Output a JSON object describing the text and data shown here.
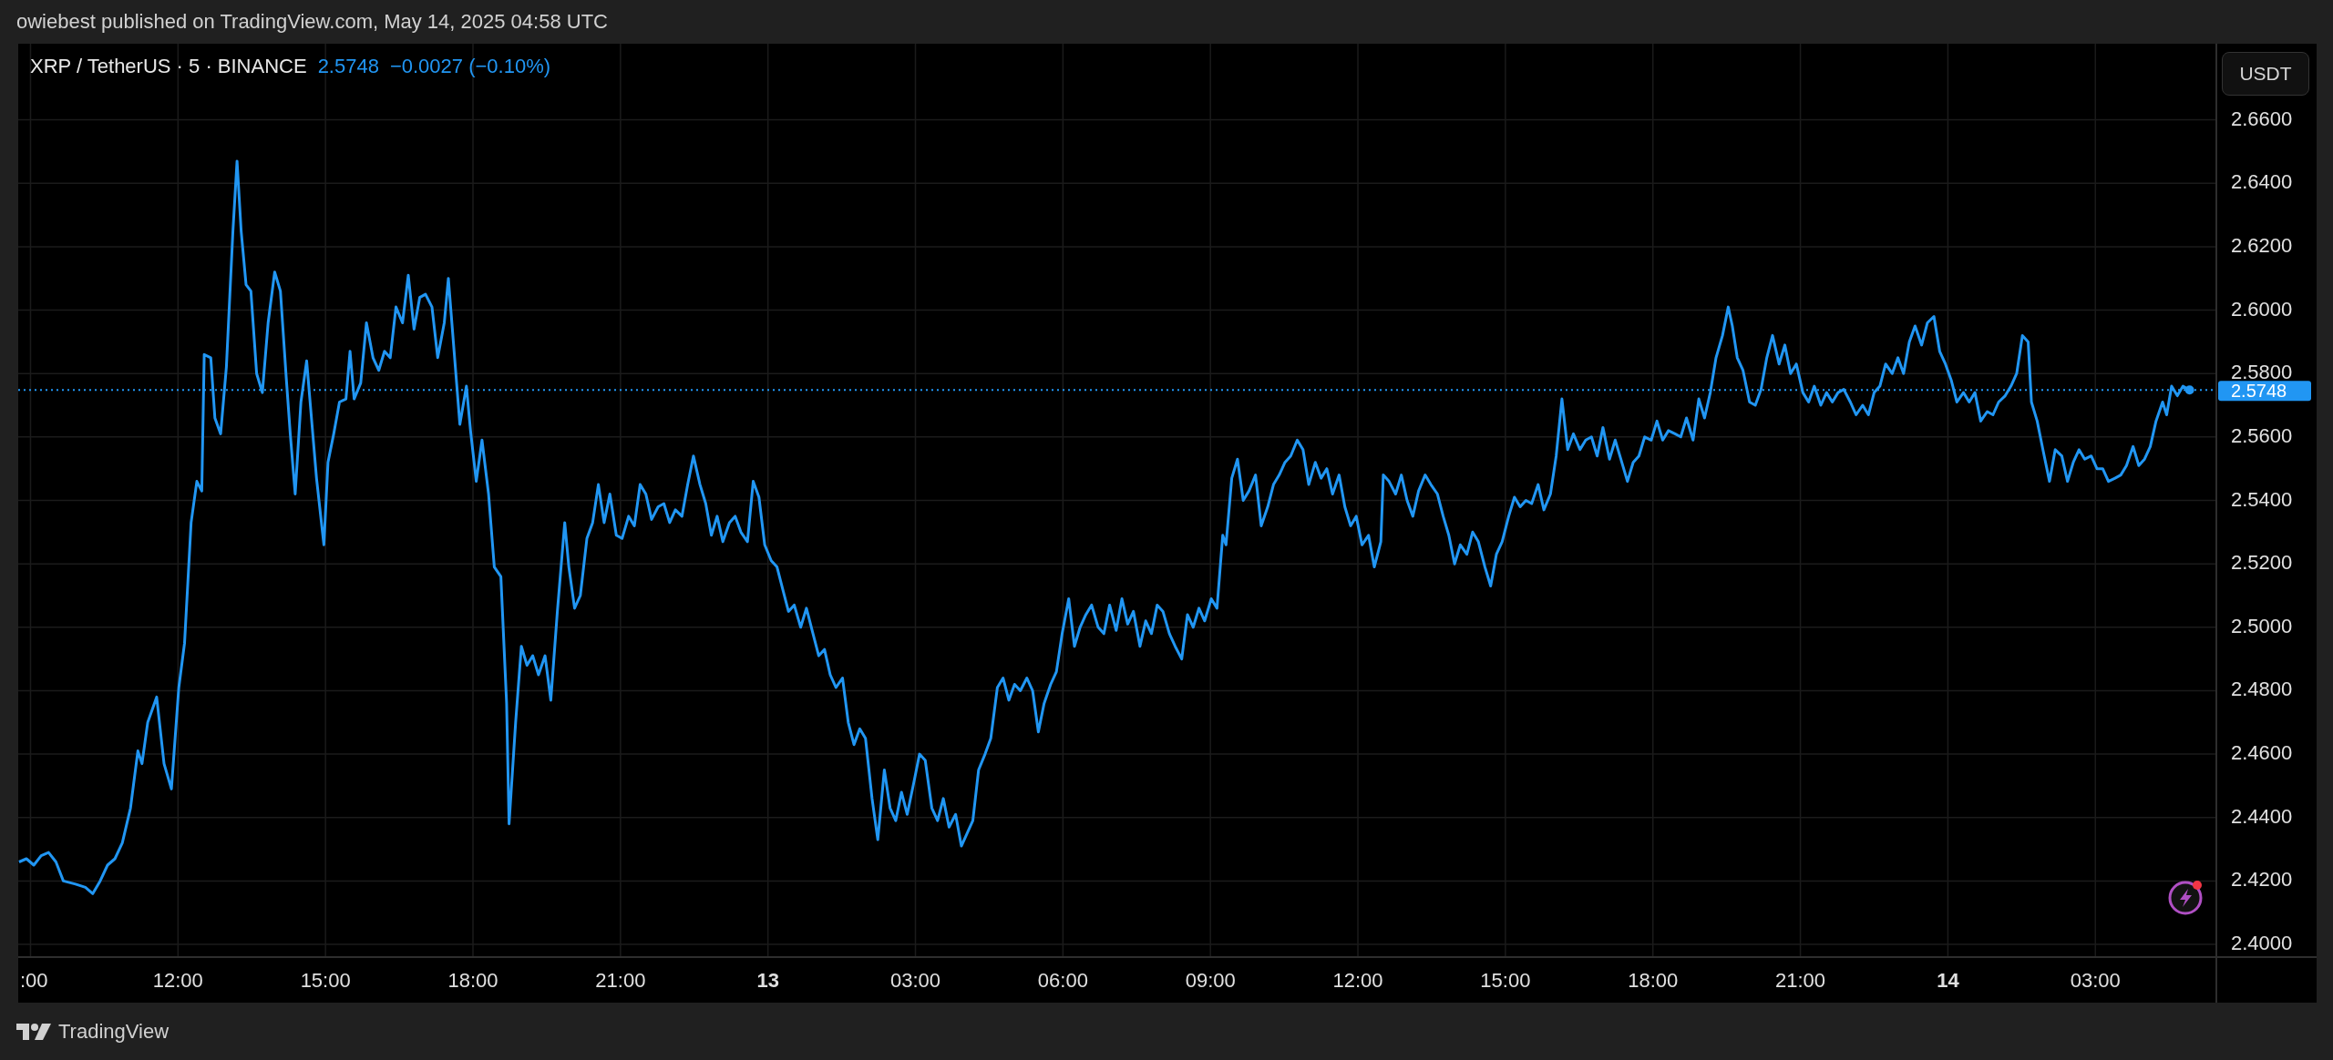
{
  "header": {
    "text": "owiebest published on TradingView.com, May 14, 2025 04:58 UTC"
  },
  "legend": {
    "symbol": "XRP / TetherUS · 5 · BINANCE",
    "price": "2.5748",
    "change": "−0.0027 (−0.10%)"
  },
  "currency_button": {
    "label": "USDT"
  },
  "chart": {
    "chart_data": {
      "type": "line",
      "x": [
        "2025-05-12T08:46",
        "2025-05-12T08:55",
        "2025-05-12T09:04",
        "2025-05-12T09:13",
        "2025-05-12T09:22",
        "2025-05-12T09:31",
        "2025-05-12T09:40",
        "2025-05-12T09:55",
        "2025-05-12T10:07",
        "2025-05-12T10:16",
        "2025-05-12T10:25",
        "2025-05-12T10:34",
        "2025-05-12T10:43",
        "2025-05-12T10:52",
        "2025-05-12T11:02",
        "2025-05-12T11:11",
        "2025-05-12T11:16",
        "2025-05-12T11:23",
        "2025-05-12T11:34",
        "2025-05-12T11:43",
        "2025-05-12T11:52",
        "2025-05-12T12:01",
        "2025-05-12T12:08",
        "2025-05-12T12:16",
        "2025-05-12T12:23",
        "2025-05-12T12:29",
        "2025-05-12T12:32",
        "2025-05-12T12:40",
        "2025-05-12T12:45",
        "2025-05-12T12:52",
        "2025-05-12T12:59",
        "2025-05-12T13:07",
        "2025-05-12T13:12",
        "2025-05-12T13:17",
        "2025-05-12T13:23",
        "2025-05-12T13:29",
        "2025-05-12T13:36",
        "2025-05-12T13:43",
        "2025-05-12T13:50",
        "2025-05-12T13:58",
        "2025-05-12T14:05",
        "2025-05-12T14:12",
        "2025-05-12T14:17",
        "2025-05-12T14:23",
        "2025-05-12T14:30",
        "2025-05-12T14:37",
        "2025-05-12T14:49",
        "2025-05-12T14:58",
        "2025-05-12T15:03",
        "2025-05-12T15:10",
        "2025-05-12T15:17",
        "2025-05-12T15:25",
        "2025-05-12T15:30",
        "2025-05-12T15:35",
        "2025-05-12T15:43",
        "2025-05-12T15:50",
        "2025-05-12T15:58",
        "2025-05-12T16:05",
        "2025-05-12T16:12",
        "2025-05-12T16:19",
        "2025-05-12T16:26",
        "2025-05-12T16:34",
        "2025-05-12T16:41",
        "2025-05-12T16:48",
        "2025-05-12T16:55",
        "2025-05-12T17:02",
        "2025-05-12T17:10",
        "2025-05-12T17:17",
        "2025-05-12T17:25",
        "2025-05-12T17:30",
        "2025-05-12T17:37",
        "2025-05-12T17:44",
        "2025-05-12T17:52",
        "2025-05-12T17:57",
        "2025-05-12T18:04",
        "2025-05-12T18:11",
        "2025-05-12T18:19",
        "2025-05-12T18:26",
        "2025-05-12T18:34",
        "2025-05-12T18:41",
        "2025-05-12T18:44",
        "2025-05-12T18:52",
        "2025-05-12T18:59",
        "2025-05-12T19:06",
        "2025-05-12T19:13",
        "2025-05-12T19:20",
        "2025-05-12T19:28",
        "2025-05-12T19:35",
        "2025-05-12T19:43",
        "2025-05-12T19:52",
        "2025-05-12T19:57",
        "2025-05-12T20:04",
        "2025-05-12T20:11",
        "2025-05-12T20:19",
        "2025-05-12T20:26",
        "2025-05-12T20:33",
        "2025-05-12T20:40",
        "2025-05-12T20:47",
        "2025-05-12T20:55",
        "2025-05-12T21:02",
        "2025-05-12T21:10",
        "2025-05-12T21:17",
        "2025-05-12T21:24",
        "2025-05-12T21:31",
        "2025-05-12T21:38",
        "2025-05-12T21:46",
        "2025-05-12T21:53",
        "2025-05-12T22:00",
        "2025-05-12T22:07",
        "2025-05-12T22:15",
        "2025-05-12T22:22",
        "2025-05-12T22:29",
        "2025-05-12T22:37",
        "2025-05-12T22:44",
        "2025-05-12T22:51",
        "2025-05-12T22:58",
        "2025-05-12T23:05",
        "2025-05-12T23:13",
        "2025-05-12T23:20",
        "2025-05-12T23:27",
        "2025-05-12T23:35",
        "2025-05-12T23:42",
        "2025-05-12T23:49",
        "2025-05-12T23:56",
        "2025-05-13T00:04",
        "2025-05-13T00:11",
        "2025-05-13T00:18",
        "2025-05-13T00:25",
        "2025-05-13T00:32",
        "2025-05-13T00:40",
        "2025-05-13T00:47",
        "2025-05-13T00:55",
        "2025-05-13T01:02",
        "2025-05-13T01:09",
        "2025-05-13T01:16",
        "2025-05-13T01:23",
        "2025-05-13T01:31",
        "2025-05-13T01:38",
        "2025-05-13T01:45",
        "2025-05-13T01:52",
        "2025-05-13T01:59",
        "2025-05-13T02:07",
        "2025-05-13T02:14",
        "2025-05-13T02:22",
        "2025-05-13T02:29",
        "2025-05-13T02:36",
        "2025-05-13T02:43",
        "2025-05-13T02:50",
        "2025-05-13T02:58",
        "2025-05-13T03:05",
        "2025-05-13T03:12",
        "2025-05-13T03:20",
        "2025-05-13T03:27",
        "2025-05-13T03:34",
        "2025-05-13T03:41",
        "2025-05-13T03:49",
        "2025-05-13T03:56",
        "2025-05-13T04:03",
        "2025-05-13T04:10",
        "2025-05-13T04:17",
        "2025-05-13T04:25",
        "2025-05-13T04:32",
        "2025-05-13T04:40",
        "2025-05-13T04:47",
        "2025-05-13T04:54",
        "2025-05-13T05:01",
        "2025-05-13T05:08",
        "2025-05-13T05:16",
        "2025-05-13T05:23",
        "2025-05-13T05:30",
        "2025-05-13T05:37",
        "2025-05-13T05:45",
        "2025-05-13T05:52",
        "2025-05-13T05:59",
        "2025-05-13T06:07",
        "2025-05-13T06:14",
        "2025-05-13T06:21",
        "2025-05-13T06:28",
        "2025-05-13T06:35",
        "2025-05-13T06:43",
        "2025-05-13T06:50",
        "2025-05-13T06:57",
        "2025-05-13T07:05",
        "2025-05-13T07:12",
        "2025-05-13T07:19",
        "2025-05-13T07:26",
        "2025-05-13T07:34",
        "2025-05-13T07:41",
        "2025-05-13T07:48",
        "2025-05-13T07:55",
        "2025-05-13T08:02",
        "2025-05-13T08:10",
        "2025-05-13T08:17",
        "2025-05-13T08:25",
        "2025-05-13T08:32",
        "2025-05-13T08:39",
        "2025-05-13T08:46",
        "2025-05-13T08:53",
        "2025-05-13T09:01",
        "2025-05-13T09:08",
        "2025-05-13T09:15",
        "2025-05-13T09:19",
        "2025-05-13T09:26",
        "2025-05-13T09:33",
        "2025-05-13T09:40",
        "2025-05-13T09:47",
        "2025-05-13T09:55",
        "2025-05-13T10:02",
        "2025-05-13T10:10",
        "2025-05-13T10:17",
        "2025-05-13T10:24",
        "2025-05-13T10:31",
        "2025-05-13T10:38",
        "2025-05-13T10:46",
        "2025-05-13T10:53",
        "2025-05-13T11:00",
        "2025-05-13T11:08",
        "2025-05-13T11:15",
        "2025-05-13T11:22",
        "2025-05-13T11:29",
        "2025-05-13T11:37",
        "2025-05-13T11:44",
        "2025-05-13T11:51",
        "2025-05-13T11:58",
        "2025-05-13T12:05",
        "2025-05-13T12:13",
        "2025-05-13T12:20",
        "2025-05-13T12:28",
        "2025-05-13T12:31",
        "2025-05-13T12:38",
        "2025-05-13T12:46",
        "2025-05-13T12:53",
        "2025-05-13T13:00",
        "2025-05-13T13:07",
        "2025-05-13T13:14",
        "2025-05-13T13:22",
        "2025-05-13T13:29",
        "2025-05-13T13:37",
        "2025-05-13T13:44",
        "2025-05-13T13:51",
        "2025-05-13T13:58",
        "2025-05-13T14:05",
        "2025-05-13T14:13",
        "2025-05-13T14:20",
        "2025-05-13T14:27",
        "2025-05-13T14:35",
        "2025-05-13T14:42",
        "2025-05-13T14:49",
        "2025-05-13T14:56",
        "2025-05-13T15:04",
        "2025-05-13T15:11",
        "2025-05-13T15:18",
        "2025-05-13T15:25",
        "2025-05-13T15:32",
        "2025-05-13T15:40",
        "2025-05-13T15:47",
        "2025-05-13T15:55",
        "2025-05-13T16:02",
        "2025-05-13T16:09",
        "2025-05-13T16:16",
        "2025-05-13T16:23",
        "2025-05-13T16:31",
        "2025-05-13T16:38",
        "2025-05-13T16:45",
        "2025-05-13T16:52",
        "2025-05-13T16:59",
        "2025-05-13T17:07",
        "2025-05-13T17:14",
        "2025-05-13T17:22",
        "2025-05-13T17:29",
        "2025-05-13T17:36",
        "2025-05-13T17:43",
        "2025-05-13T17:50",
        "2025-05-13T17:58",
        "2025-05-13T18:05",
        "2025-05-13T18:12",
        "2025-05-13T18:19",
        "2025-05-13T18:27",
        "2025-05-13T18:34",
        "2025-05-13T18:41",
        "2025-05-13T18:49",
        "2025-05-13T18:56",
        "2025-05-13T19:03",
        "2025-05-13T19:10",
        "2025-05-13T19:17",
        "2025-05-13T19:25",
        "2025-05-13T19:32",
        "2025-05-13T19:37",
        "2025-05-13T19:43",
        "2025-05-13T19:50",
        "2025-05-13T19:58",
        "2025-05-13T20:05",
        "2025-05-13T20:12",
        "2025-05-13T20:19",
        "2025-05-13T20:26",
        "2025-05-13T20:34",
        "2025-05-13T20:41",
        "2025-05-13T20:48",
        "2025-05-13T20:55",
        "2025-05-13T21:03",
        "2025-05-13T21:10",
        "2025-05-13T21:17",
        "2025-05-13T21:25",
        "2025-05-13T21:32",
        "2025-05-13T21:39",
        "2025-05-13T21:46",
        "2025-05-13T21:53",
        "2025-05-13T22:01",
        "2025-05-13T22:08",
        "2025-05-13T22:16",
        "2025-05-13T22:23",
        "2025-05-13T22:30",
        "2025-05-13T22:37",
        "2025-05-13T22:44",
        "2025-05-13T22:52",
        "2025-05-13T22:59",
        "2025-05-13T23:06",
        "2025-05-13T23:13",
        "2025-05-13T23:20",
        "2025-05-13T23:28",
        "2025-05-13T23:35",
        "2025-05-13T23:43",
        "2025-05-13T23:50",
        "2025-05-13T23:57",
        "2025-05-14T00:04",
        "2025-05-14T00:11",
        "2025-05-14T00:19",
        "2025-05-14T00:26",
        "2025-05-14T00:33",
        "2025-05-14T00:40",
        "2025-05-14T00:48",
        "2025-05-14T00:55",
        "2025-05-14T01:02",
        "2025-05-14T01:10",
        "2025-05-14T01:17",
        "2025-05-14T01:24",
        "2025-05-14T01:31",
        "2025-05-14T01:38",
        "2025-05-14T01:42",
        "2025-05-14T01:49",
        "2025-05-14T01:56",
        "2025-05-14T02:04",
        "2025-05-14T02:11",
        "2025-05-14T02:19",
        "2025-05-14T02:26",
        "2025-05-14T02:33",
        "2025-05-14T02:40",
        "2025-05-14T02:47",
        "2025-05-14T02:55",
        "2025-05-14T03:02",
        "2025-05-14T03:09",
        "2025-05-14T03:16",
        "2025-05-14T03:24",
        "2025-05-14T03:31",
        "2025-05-14T03:38",
        "2025-05-14T03:46",
        "2025-05-14T03:53",
        "2025-05-14T04:00",
        "2025-05-14T04:07",
        "2025-05-14T04:14",
        "2025-05-14T04:22",
        "2025-05-14T04:27",
        "2025-05-14T04:33",
        "2025-05-14T04:40",
        "2025-05-14T04:47",
        "2025-05-14T04:55"
      ],
      "series": [
        {
          "color": "#2196f3",
          "values": [
            2.426,
            2.427,
            2.425,
            2.428,
            2.429,
            2.426,
            2.42,
            2.419,
            2.418,
            2.416,
            2.42,
            2.425,
            2.427,
            2.432,
            2.443,
            2.461,
            2.457,
            2.47,
            2.478,
            2.457,
            2.449,
            2.481,
            2.495,
            2.533,
            2.546,
            2.543,
            2.586,
            2.585,
            2.566,
            2.561,
            2.582,
            2.625,
            2.647,
            2.625,
            2.608,
            2.606,
            2.58,
            2.574,
            2.596,
            2.612,
            2.606,
            2.579,
            2.561,
            2.542,
            2.571,
            2.584,
            2.547,
            2.526,
            2.552,
            2.561,
            2.571,
            2.572,
            2.587,
            2.572,
            2.577,
            2.596,
            2.585,
            2.581,
            2.587,
            2.585,
            2.601,
            2.596,
            2.611,
            2.594,
            2.604,
            2.605,
            2.601,
            2.585,
            2.596,
            2.61,
            2.587,
            2.564,
            2.576,
            2.562,
            2.546,
            2.559,
            2.542,
            2.519,
            2.516,
            2.476,
            2.438,
            2.47,
            2.494,
            2.488,
            2.491,
            2.485,
            2.491,
            2.477,
            2.505,
            2.533,
            2.519,
            2.506,
            2.51,
            2.528,
            2.533,
            2.545,
            2.533,
            2.542,
            2.529,
            2.528,
            2.535,
            2.532,
            2.545,
            2.542,
            2.534,
            2.538,
            2.539,
            2.533,
            2.537,
            2.535,
            2.545,
            2.554,
            2.545,
            2.539,
            2.529,
            2.535,
            2.527,
            2.533,
            2.535,
            2.53,
            2.527,
            2.546,
            2.541,
            2.526,
            2.521,
            2.519,
            2.512,
            2.505,
            2.507,
            2.5,
            2.506,
            2.498,
            2.491,
            2.493,
            2.485,
            2.481,
            2.484,
            2.47,
            2.463,
            2.468,
            2.465,
            2.446,
            2.433,
            2.455,
            2.443,
            2.439,
            2.448,
            2.441,
            2.451,
            2.46,
            2.458,
            2.443,
            2.439,
            2.446,
            2.437,
            2.441,
            2.431,
            2.435,
            2.439,
            2.455,
            2.46,
            2.465,
            2.481,
            2.484,
            2.477,
            2.482,
            2.48,
            2.484,
            2.48,
            2.467,
            2.476,
            2.482,
            2.486,
            2.498,
            2.509,
            2.494,
            2.5,
            2.504,
            2.507,
            2.5,
            2.498,
            2.507,
            2.499,
            2.509,
            2.501,
            2.505,
            2.494,
            2.502,
            2.498,
            2.507,
            2.505,
            2.498,
            2.494,
            2.49,
            2.504,
            2.5,
            2.506,
            2.502,
            2.509,
            2.506,
            2.529,
            2.526,
            2.547,
            2.553,
            2.54,
            2.543,
            2.548,
            2.532,
            2.538,
            2.545,
            2.548,
            2.552,
            2.554,
            2.559,
            2.556,
            2.545,
            2.552,
            2.547,
            2.55,
            2.542,
            2.548,
            2.538,
            2.532,
            2.535,
            2.526,
            2.529,
            2.519,
            2.527,
            2.548,
            2.546,
            2.542,
            2.548,
            2.54,
            2.535,
            2.543,
            2.548,
            2.545,
            2.542,
            2.535,
            2.529,
            2.52,
            2.526,
            2.523,
            2.53,
            2.527,
            2.519,
            2.513,
            2.523,
            2.527,
            2.535,
            2.541,
            2.538,
            2.54,
            2.539,
            2.545,
            2.537,
            2.542,
            2.554,
            2.572,
            2.556,
            2.561,
            2.556,
            2.559,
            2.56,
            2.554,
            2.563,
            2.553,
            2.559,
            2.552,
            2.546,
            2.552,
            2.554,
            2.56,
            2.559,
            2.565,
            2.559,
            2.562,
            2.561,
            2.56,
            2.566,
            2.559,
            2.572,
            2.566,
            2.574,
            2.585,
            2.592,
            2.601,
            2.595,
            2.585,
            2.581,
            2.571,
            2.57,
            2.575,
            2.585,
            2.592,
            2.583,
            2.589,
            2.58,
            2.583,
            2.574,
            2.571,
            2.576,
            2.57,
            2.574,
            2.571,
            2.574,
            2.575,
            2.571,
            2.567,
            2.57,
            2.567,
            2.574,
            2.576,
            2.583,
            2.58,
            2.585,
            2.58,
            2.59,
            2.595,
            2.589,
            2.596,
            2.598,
            2.587,
            2.583,
            2.578,
            2.571,
            2.574,
            2.571,
            2.574,
            2.565,
            2.568,
            2.567,
            2.571,
            2.573,
            2.576,
            2.58,
            2.592,
            2.59,
            2.571,
            2.565,
            2.556,
            2.546,
            2.556,
            2.554,
            2.546,
            2.552,
            2.556,
            2.553,
            2.554,
            2.55,
            2.55,
            2.546,
            2.547,
            2.548,
            2.551,
            2.557,
            2.551,
            2.553,
            2.557,
            2.565,
            2.571,
            2.567,
            2.576,
            2.573,
            2.576,
            2.5748
          ]
        }
      ],
      "xlim": [
        "2025-05-12T08:45",
        "2025-05-14T07:30"
      ],
      "ylim": [
        2.396,
        2.684
      ],
      "grid": true,
      "xticks": [
        {
          "value": "2025-05-12T09:00",
          "label": ":00"
        },
        {
          "value": "2025-05-12T12:00",
          "label": "12:00"
        },
        {
          "value": "2025-05-12T15:00",
          "label": "15:00"
        },
        {
          "value": "2025-05-12T18:00",
          "label": "18:00"
        },
        {
          "value": "2025-05-12T21:00",
          "label": "21:00"
        },
        {
          "value": "2025-05-13T00:00",
          "label": "13"
        },
        {
          "value": "2025-05-13T03:00",
          "label": "03:00"
        },
        {
          "value": "2025-05-13T06:00",
          "label": "06:00"
        },
        {
          "value": "2025-05-13T09:00",
          "label": "09:00"
        },
        {
          "value": "2025-05-13T12:00",
          "label": "12:00"
        },
        {
          "value": "2025-05-13T15:00",
          "label": "15:00"
        },
        {
          "value": "2025-05-13T18:00",
          "label": "18:00"
        },
        {
          "value": "2025-05-13T21:00",
          "label": "21:00"
        },
        {
          "value": "2025-05-14T00:00",
          "label": "14"
        },
        {
          "value": "2025-05-14T03:00",
          "label": "03:00"
        }
      ],
      "yticks": [
        {
          "value": 2.66,
          "label": "2.6600"
        },
        {
          "value": 2.64,
          "label": "2.6400"
        },
        {
          "value": 2.62,
          "label": "2.6200"
        },
        {
          "value": 2.6,
          "label": "2.6000"
        },
        {
          "value": 2.58,
          "label": "2.5800"
        },
        {
          "value": 2.56,
          "label": "2.5600"
        },
        {
          "value": 2.54,
          "label": "2.5400"
        },
        {
          "value": 2.52,
          "label": "2.5200"
        },
        {
          "value": 2.5,
          "label": "2.5000"
        },
        {
          "value": 2.48,
          "label": "2.4800"
        },
        {
          "value": 2.46,
          "label": "2.4600"
        },
        {
          "value": 2.44,
          "label": "2.4400"
        },
        {
          "value": 2.42,
          "label": "2.4200"
        },
        {
          "value": 2.4,
          "label": "2.4000"
        }
      ],
      "ref_lines": [
        {
          "axis": "y",
          "value": 2.5748,
          "label": "2.5748",
          "color": "#2196f3"
        }
      ]
    }
  },
  "footer": {
    "brand": "TradingView"
  }
}
